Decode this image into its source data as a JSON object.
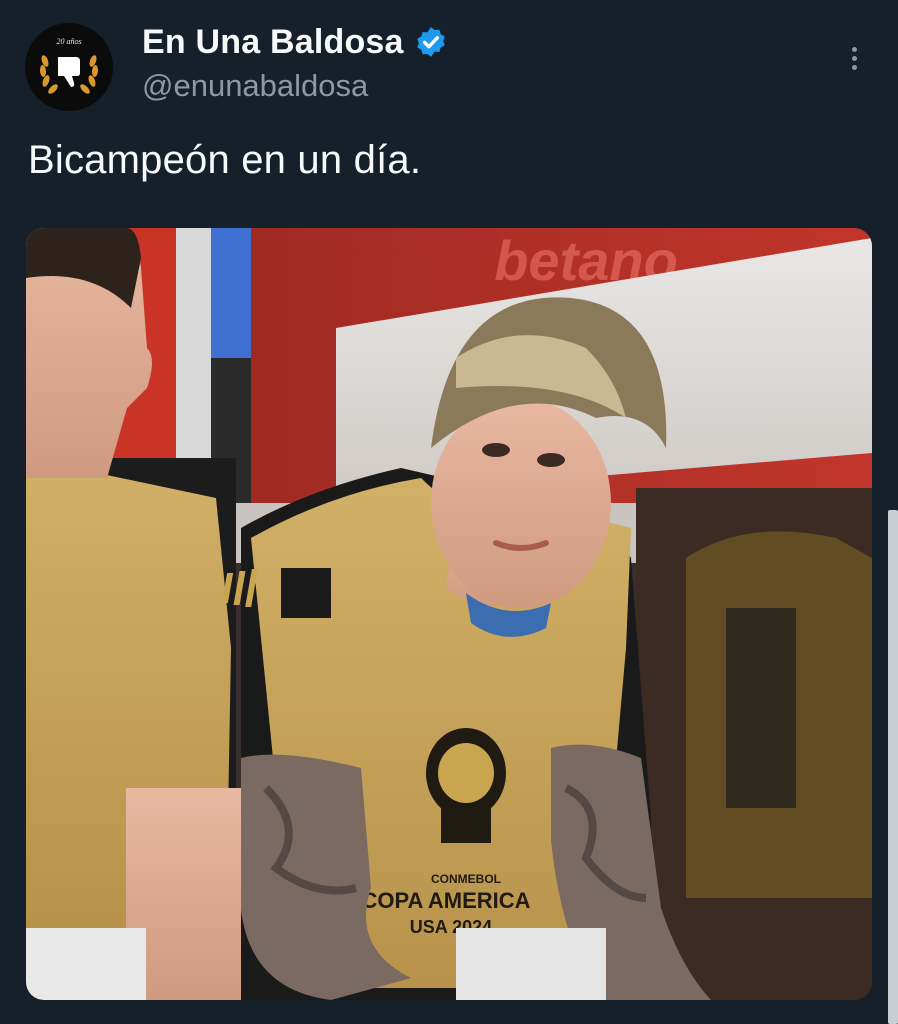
{
  "author": {
    "display_name": "En Una Baldosa",
    "handle": "@enunabaldosa",
    "verified": true,
    "avatar_text": "20 años",
    "avatar_icon": "thumbs-down-in-laurel-icon"
  },
  "tweet": {
    "text": "Bicampeón en un día."
  },
  "media": {
    "kind": "photo",
    "shirt_print_top": "CONMEBOL",
    "shirt_print_main": "COPA AMERICA",
    "shirt_print_bottom": "USA 2024",
    "banner_text": "betano"
  },
  "icons": {
    "verified": "verified-badge-icon",
    "more": "more-options-icon"
  },
  "colors": {
    "background": "#15202b",
    "verified_blue": "#1d9bf0",
    "secondary_text": "#8b98a5",
    "bib_yellow": "#c9a550"
  }
}
